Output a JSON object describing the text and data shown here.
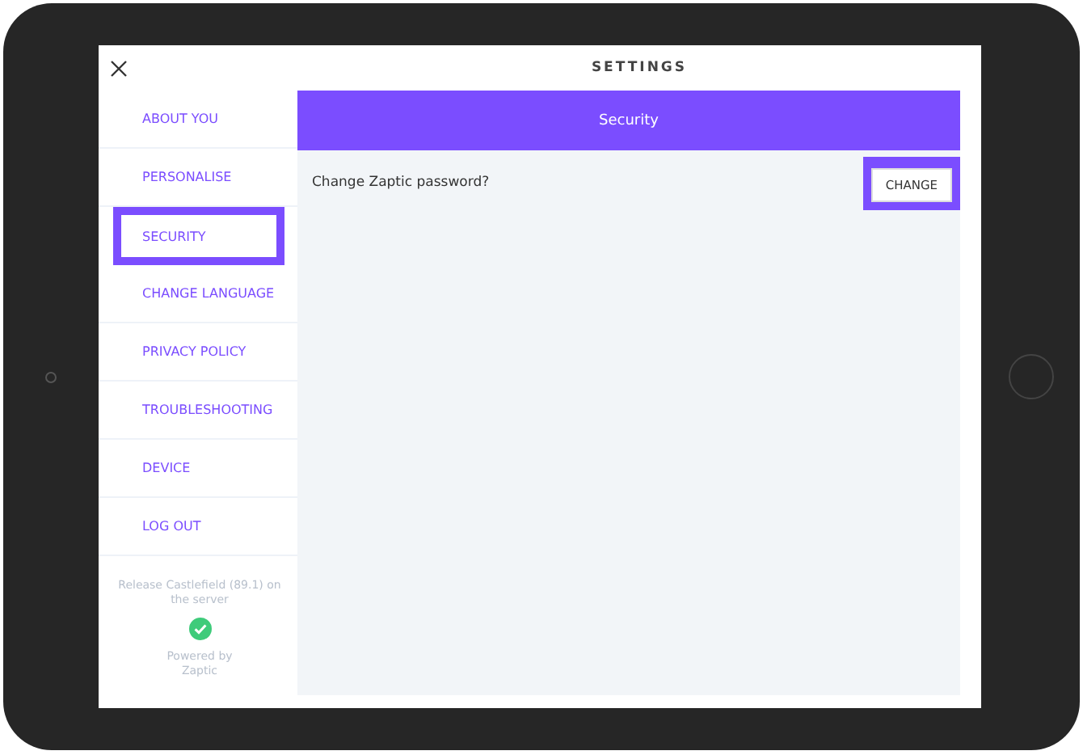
{
  "window": {
    "title": "SETTINGS"
  },
  "sidebar": {
    "items": [
      {
        "label": "ABOUT YOU",
        "selected": false
      },
      {
        "label": "PERSONALISE",
        "selected": false
      },
      {
        "label": "SECURITY",
        "selected": true
      },
      {
        "label": "CHANGE LANGUAGE",
        "selected": false
      },
      {
        "label": "PRIVACY POLICY",
        "selected": false
      },
      {
        "label": "TROUBLESHOOTING",
        "selected": false
      },
      {
        "label": "DEVICE",
        "selected": false
      },
      {
        "label": "LOG OUT",
        "selected": false
      }
    ],
    "release_note": "Release Castlefield (89.1) on the server",
    "powered_by": "Powered by Zaptic"
  },
  "panel": {
    "header": "Security",
    "rows": [
      {
        "label": "Change Zaptic password?",
        "button": "CHANGE",
        "highlighted": true
      }
    ]
  }
}
